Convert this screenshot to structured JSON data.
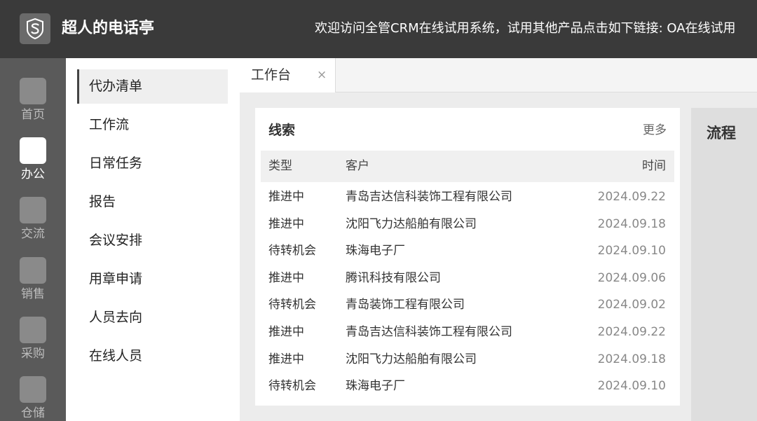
{
  "header": {
    "logo_icon": "s-logo-icon",
    "app_name": "超人的电话亭",
    "notice": "欢迎访问全管CRM在线试用系统，试用其他产品点击如下链接: OA在线试用"
  },
  "rail": {
    "items": [
      {
        "label": "首页",
        "icon": "home-icon"
      },
      {
        "label": "办公",
        "icon": "office-icon"
      },
      {
        "label": "交流",
        "icon": "chat-icon"
      },
      {
        "label": "销售",
        "icon": "sales-icon"
      },
      {
        "label": "采购",
        "icon": "purchase-icon"
      },
      {
        "label": "仓储",
        "icon": "warehouse-icon"
      }
    ],
    "active": "办公"
  },
  "submenu": {
    "items": [
      {
        "label": "代办清单"
      },
      {
        "label": "工作流"
      },
      {
        "label": "日常任务"
      },
      {
        "label": "报告"
      },
      {
        "label": "会议安排"
      },
      {
        "label": "用章申请"
      },
      {
        "label": "人员去向"
      },
      {
        "label": "在线人员"
      }
    ],
    "active": "代办清单"
  },
  "tabs": [
    {
      "label": "工作台",
      "close": "×"
    }
  ],
  "leads_card": {
    "title": "线索",
    "more": "更多",
    "columns": [
      "类型",
      "客户",
      "时间"
    ],
    "rows": [
      {
        "type": "推进中",
        "customer": "青岛吉达信科装饰工程有限公司",
        "time": "2024.09.22"
      },
      {
        "type": "推进中",
        "customer": "沈阳飞力达船舶有限公司",
        "time": "2024.09.18"
      },
      {
        "type": "待转机会",
        "customer": "珠海电子厂",
        "time": "2024.09.10"
      },
      {
        "type": "推进中",
        "customer": "腾讯科技有限公司",
        "time": "2024.09.06"
      },
      {
        "type": "待转机会",
        "customer": "青岛装饰工程有限公司",
        "time": "2024.09.02"
      },
      {
        "type": "推进中",
        "customer": "青岛吉达信科装饰工程有限公司",
        "time": "2024.09.22"
      },
      {
        "type": "推进中",
        "customer": "沈阳飞力达船舶有限公司",
        "time": "2024.09.18"
      },
      {
        "type": "待转机会",
        "customer": "珠海电子厂",
        "time": "2024.09.10"
      }
    ]
  },
  "process_card": {
    "title": "流程"
  }
}
